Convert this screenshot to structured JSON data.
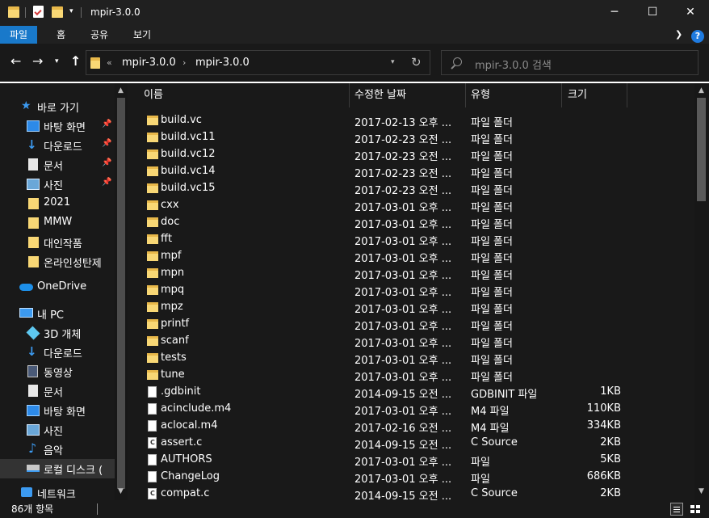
{
  "window": {
    "title": "mpir-3.0.0",
    "minimize": "─",
    "maximize": "☐",
    "close": "✕"
  },
  "ribbon": {
    "tabs": [
      "파일",
      "홈",
      "공유",
      "보기"
    ],
    "active_tab": "파일",
    "help": "?"
  },
  "address": {
    "overflow": "«",
    "crumbs": [
      "mpir-3.0.0",
      "mpir-3.0.0"
    ],
    "separator": "›",
    "search_placeholder": "mpir-3.0.0 검색"
  },
  "nav_pane": {
    "quick_access": "바로 가기",
    "pinned": [
      {
        "label": "바탕 화면",
        "icon": "desktop-icon"
      },
      {
        "label": "다운로드",
        "icon": "download-icon"
      },
      {
        "label": "문서",
        "icon": "document-icon"
      },
      {
        "label": "사진",
        "icon": "pictures-icon"
      }
    ],
    "folders": [
      "2021",
      "MMW",
      "대인작품",
      "온라인성탄제"
    ],
    "onedrive": "OneDrive",
    "this_pc": "내 PC",
    "pc_items": [
      {
        "label": "3D 개체",
        "icon": "3d-objects-icon"
      },
      {
        "label": "다운로드",
        "icon": "download-icon"
      },
      {
        "label": "동영상",
        "icon": "video-icon"
      },
      {
        "label": "문서",
        "icon": "document-icon"
      },
      {
        "label": "바탕 화면",
        "icon": "desktop-icon"
      },
      {
        "label": "사진",
        "icon": "pictures-icon"
      },
      {
        "label": "음악",
        "icon": "music-icon"
      },
      {
        "label": "로컬 디스크 (",
        "icon": "drive-icon"
      }
    ],
    "network": "네트워크"
  },
  "columns": {
    "name": "이름",
    "date": "수정한 날짜",
    "type": "유형",
    "size": "크기"
  },
  "files": [
    {
      "name": "build.vc",
      "date": "2017-02-13 오후 ...",
      "type": "파일 폴더",
      "size": "",
      "kind": "folder"
    },
    {
      "name": "build.vc11",
      "date": "2017-02-23 오전 ...",
      "type": "파일 폴더",
      "size": "",
      "kind": "folder"
    },
    {
      "name": "build.vc12",
      "date": "2017-02-23 오전 ...",
      "type": "파일 폴더",
      "size": "",
      "kind": "folder"
    },
    {
      "name": "build.vc14",
      "date": "2017-02-23 오전 ...",
      "type": "파일 폴더",
      "size": "",
      "kind": "folder"
    },
    {
      "name": "build.vc15",
      "date": "2017-02-23 오전 ...",
      "type": "파일 폴더",
      "size": "",
      "kind": "folder"
    },
    {
      "name": "cxx",
      "date": "2017-03-01 오후 ...",
      "type": "파일 폴더",
      "size": "",
      "kind": "folder"
    },
    {
      "name": "doc",
      "date": "2017-03-01 오후 ...",
      "type": "파일 폴더",
      "size": "",
      "kind": "folder"
    },
    {
      "name": "fft",
      "date": "2017-03-01 오후 ...",
      "type": "파일 폴더",
      "size": "",
      "kind": "folder"
    },
    {
      "name": "mpf",
      "date": "2017-03-01 오후 ...",
      "type": "파일 폴더",
      "size": "",
      "kind": "folder"
    },
    {
      "name": "mpn",
      "date": "2017-03-01 오후 ...",
      "type": "파일 폴더",
      "size": "",
      "kind": "folder"
    },
    {
      "name": "mpq",
      "date": "2017-03-01 오후 ...",
      "type": "파일 폴더",
      "size": "",
      "kind": "folder"
    },
    {
      "name": "mpz",
      "date": "2017-03-01 오후 ...",
      "type": "파일 폴더",
      "size": "",
      "kind": "folder"
    },
    {
      "name": "printf",
      "date": "2017-03-01 오후 ...",
      "type": "파일 폴더",
      "size": "",
      "kind": "folder"
    },
    {
      "name": "scanf",
      "date": "2017-03-01 오후 ...",
      "type": "파일 폴더",
      "size": "",
      "kind": "folder"
    },
    {
      "name": "tests",
      "date": "2017-03-01 오후 ...",
      "type": "파일 폴더",
      "size": "",
      "kind": "folder"
    },
    {
      "name": "tune",
      "date": "2017-03-01 오후 ...",
      "type": "파일 폴더",
      "size": "",
      "kind": "folder"
    },
    {
      "name": ".gdbinit",
      "date": "2014-09-15 오전 ...",
      "type": "GDBINIT 파일",
      "size": "1KB",
      "kind": "file"
    },
    {
      "name": "acinclude.m4",
      "date": "2017-03-01 오후 ...",
      "type": "M4 파일",
      "size": "110KB",
      "kind": "file"
    },
    {
      "name": "aclocal.m4",
      "date": "2017-02-16 오전 ...",
      "type": "M4 파일",
      "size": "334KB",
      "kind": "file"
    },
    {
      "name": "assert.c",
      "date": "2014-09-15 오전 ...",
      "type": "C Source",
      "size": "2KB",
      "kind": "c"
    },
    {
      "name": "AUTHORS",
      "date": "2017-03-01 오후 ...",
      "type": "파일",
      "size": "5KB",
      "kind": "file"
    },
    {
      "name": "ChangeLog",
      "date": "2017-03-01 오후 ...",
      "type": "파일",
      "size": "686KB",
      "kind": "file"
    },
    {
      "name": "compat.c",
      "date": "2014-09-15 오전 ...",
      "type": "C Source",
      "size": "2KB",
      "kind": "c"
    }
  ],
  "status": {
    "item_count": "86개 항목"
  },
  "colors": {
    "accent": "#1979ca",
    "folder": "#f8d775",
    "background": "#191919"
  }
}
